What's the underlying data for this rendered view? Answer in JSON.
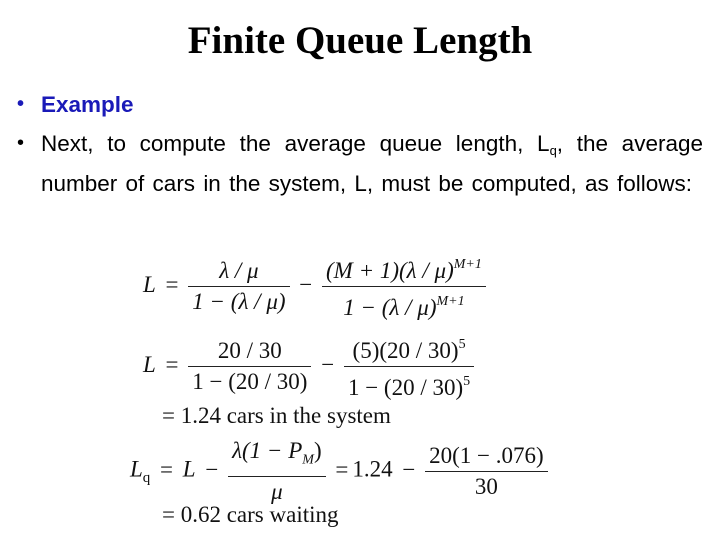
{
  "slide": {
    "title": "Finite Queue Length",
    "bullets": [
      {
        "label": "Example"
      },
      {
        "text_before": "Next, to compute the average queue length, L",
        "subscript": "q",
        "text_after": ", the average number of cars in the system, L, must be computed, as follows:"
      }
    ],
    "equations": {
      "eq1": {
        "lhs": "L",
        "eq": "=",
        "frac1_num": "λ / μ",
        "frac1_den": "1 − (λ / μ)",
        "minus": "−",
        "frac2_num_base": "(M + 1)(λ / μ)",
        "frac2_num_exp": "M+1",
        "frac2_den_base": "1 − (λ / μ)",
        "frac2_den_exp": "M+1"
      },
      "eq2": {
        "lhs": "L",
        "eq": "=",
        "frac1_num": "20 / 30",
        "frac1_den": "1 − (20 / 30)",
        "minus": "−",
        "frac2_num_base": "(5)(20 / 30)",
        "frac2_num_exp": "5",
        "frac2_den_base": "1 − (20 / 30)",
        "frac2_den_exp": "5"
      },
      "eq2_result": "= 1.24 cars in the system",
      "eq3": {
        "lhs_base": "L",
        "lhs_sub": "q",
        "eq": "=",
        "l": "L",
        "minus": "−",
        "frac1_num": "λ(1 − P",
        "frac1_num_sub": "M",
        "frac1_num_close": ")",
        "frac1_den": "μ",
        "eq2": "=",
        "value": "1.24",
        "minus2": "−",
        "frac2_num": "20(1 − .076)",
        "frac2_den": "30"
      },
      "eq3_result": "= 0.62 cars waiting"
    }
  }
}
